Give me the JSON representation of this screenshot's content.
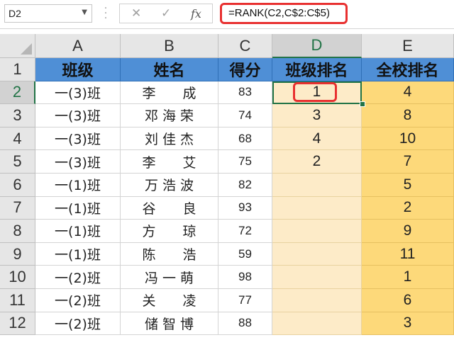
{
  "formula_bar": {
    "name_box": "D2",
    "formula": "=RANK(C2,C$2:C$5)",
    "cancel_icon": "✕",
    "enter_icon": "✓",
    "fx_label": "fx"
  },
  "columns": [
    "A",
    "B",
    "C",
    "D",
    "E"
  ],
  "header_row": [
    "班级",
    "姓名",
    "得分",
    "班级排名",
    "全校排名"
  ],
  "row_numbers": [
    "1",
    "2",
    "3",
    "4",
    "5",
    "6",
    "7",
    "8",
    "9",
    "10",
    "11",
    "12"
  ],
  "rows": [
    {
      "class": "一(3)班",
      "name": "李　　成",
      "score": "83",
      "class_rank": "1",
      "school_rank": "4"
    },
    {
      "class": "一(3)班",
      "name": "邓 海 荣",
      "score": "74",
      "class_rank": "3",
      "school_rank": "8"
    },
    {
      "class": "一(3)班",
      "name": "刘 佳 杰",
      "score": "68",
      "class_rank": "4",
      "school_rank": "10"
    },
    {
      "class": "一(3)班",
      "name": "李　　艾",
      "score": "75",
      "class_rank": "2",
      "school_rank": "7"
    },
    {
      "class": "一(1)班",
      "name": "万 浩 波",
      "score": "82",
      "class_rank": "",
      "school_rank": "5"
    },
    {
      "class": "一(1)班",
      "name": "谷　　良",
      "score": "93",
      "class_rank": "",
      "school_rank": "2"
    },
    {
      "class": "一(1)班",
      "name": "方　　琼",
      "score": "72",
      "class_rank": "",
      "school_rank": "9"
    },
    {
      "class": "一(1)班",
      "name": "陈　　浩",
      "score": "59",
      "class_rank": "",
      "school_rank": "11"
    },
    {
      "class": "一(2)班",
      "name": "冯 一 萌",
      "score": "98",
      "class_rank": "",
      "school_rank": "1"
    },
    {
      "class": "一(2)班",
      "name": "关　　凌",
      "score": "77",
      "class_rank": "",
      "school_rank": "6"
    },
    {
      "class": "一(2)班",
      "name": "储 智 博",
      "score": "88",
      "class_rank": "",
      "school_rank": "3"
    }
  ]
}
